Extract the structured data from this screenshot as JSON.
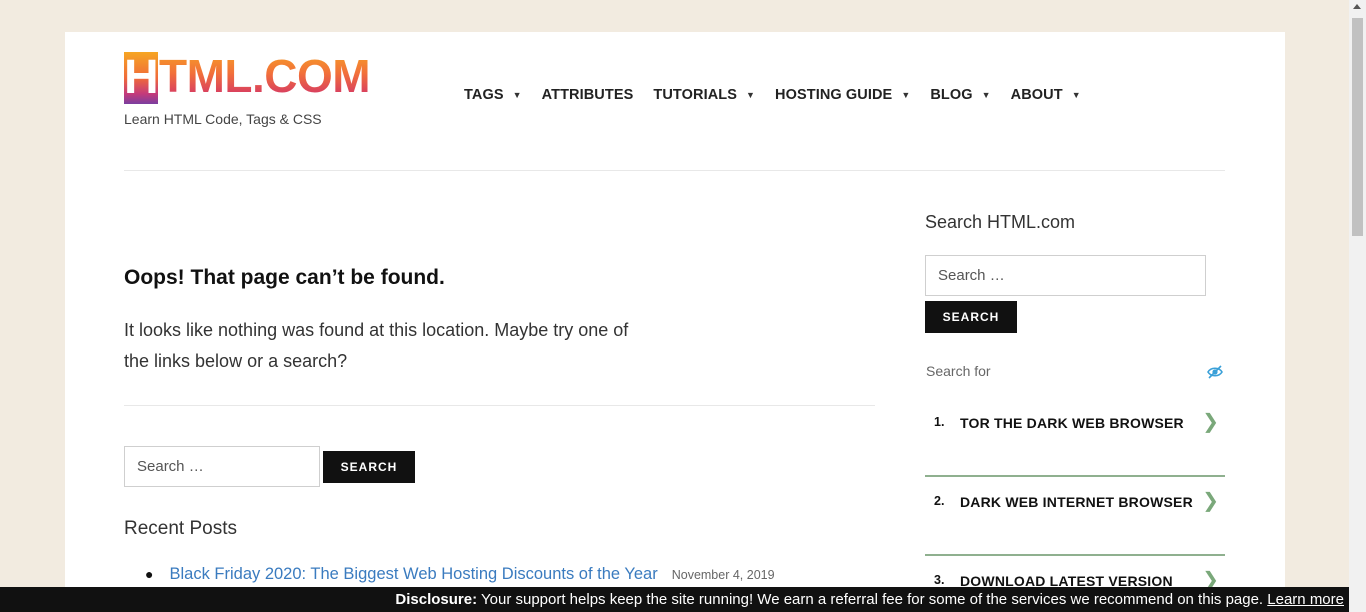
{
  "logo": {
    "badge_letter": "H",
    "text": "TML.COM",
    "tagline": "Learn HTML Code, Tags & CSS"
  },
  "nav": {
    "items": [
      {
        "label": "TAGS",
        "has_caret": true
      },
      {
        "label": "ATTRIBUTES",
        "has_caret": false
      },
      {
        "label": "TUTORIALS",
        "has_caret": true
      },
      {
        "label": "HOSTING GUIDE",
        "has_caret": true
      },
      {
        "label": "BLOG",
        "has_caret": true
      },
      {
        "label": "ABOUT",
        "has_caret": true
      }
    ],
    "caret_glyph": "▼"
  },
  "main": {
    "title": "Oops! That page can’t be found.",
    "message": "It looks like nothing was found at this location. Maybe try one of the links below or a search?",
    "search": {
      "placeholder": "Search …",
      "button": "SEARCH"
    },
    "recent_heading": "Recent Posts",
    "recent_posts": [
      {
        "title": "Black Friday 2020: The Biggest Web Hosting Discounts of the Year",
        "date": "November 4, 2019"
      }
    ]
  },
  "sidebar": {
    "title": "Search HTML.com",
    "search": {
      "placeholder": "Search …",
      "button": "SEARCH"
    },
    "search_for_label": "Search for",
    "ads": [
      {
        "num": "1.",
        "label": "TOR THE DARK WEB BROWSER"
      },
      {
        "num": "2.",
        "label": "DARK WEB INTERNET BROWSER"
      },
      {
        "num": "3.",
        "label": "DOWNLOAD LATEST VERSION"
      }
    ],
    "chevron": "❯"
  },
  "disclosure": {
    "label": "Disclosure:",
    "text": " Your support helps keep the site running! We earn a referral fee for some of the services we recommend on this page. ",
    "link": "Learn more"
  },
  "colors": {
    "background": "#f2ebe0",
    "link": "#3a7bbf",
    "accent_green": "#8fb08f",
    "button": "#111111"
  }
}
